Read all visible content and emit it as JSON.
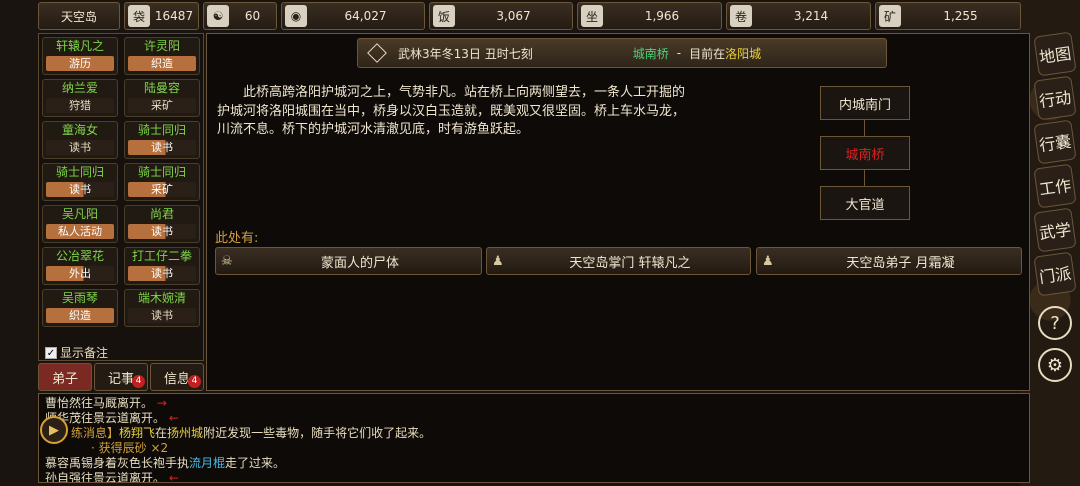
{
  "topbar": {
    "island": "天空岛",
    "resources": [
      {
        "icon": "coin-pouch-icon",
        "glyph": "袋",
        "value": "16487"
      },
      {
        "icon": "yin-yang-icon",
        "glyph": "☯",
        "value": "60"
      },
      {
        "icon": "copper-coin-icon",
        "glyph": "◉",
        "value": "64,027"
      },
      {
        "icon": "food-bowl-icon",
        "glyph": "饭",
        "value": "3,067"
      },
      {
        "icon": "meditation-icon",
        "glyph": "坐",
        "value": "1,966"
      },
      {
        "icon": "scroll-icon",
        "glyph": "卷",
        "value": "3,214"
      },
      {
        "icon": "ore-icon",
        "glyph": "矿",
        "value": "1,255"
      }
    ]
  },
  "disciples": [
    {
      "name": "轩辕凡之",
      "activity": "游历"
    },
    {
      "name": "许灵阳",
      "activity": "织造"
    },
    {
      "name": "纳兰爱",
      "activity": "狩猎"
    },
    {
      "name": "陆曼容",
      "activity": "采矿"
    },
    {
      "name": "童海女",
      "activity": "读书"
    },
    {
      "name": "骑士同归",
      "activity": "读书"
    },
    {
      "name": "骑士同归",
      "activity": "读书"
    },
    {
      "name": "骑士同归",
      "activity": "采矿"
    },
    {
      "name": "吴凡阳",
      "activity": "私人活动"
    },
    {
      "name": "尚君",
      "activity": "读书"
    },
    {
      "name": "公冶翠花",
      "activity": "外出"
    },
    {
      "name": "打工仔二拳",
      "activity": "读书"
    },
    {
      "name": "吴雨琴",
      "activity": "织造"
    },
    {
      "name": "端木婉清",
      "activity": "读书"
    }
  ],
  "show_remarks": "显示备注",
  "tabs": {
    "disciples": "弟子",
    "notes": "记事",
    "notes_badge": "4",
    "info": "信息",
    "info_badge": "4"
  },
  "header": {
    "date": "武林3年冬13日 丑时七刻",
    "location": "城南桥",
    "dash": "-",
    "current_prefix": "目前在",
    "current_city": "洛阳城"
  },
  "description": "此桥高跨洛阳护城河之上，气势非凡。站在桥上向两侧望去，一条人工开掘的护城河将洛阳城围在当中，桥身以汉白玉造就，既美观又很坚固。桥上车水马龙，川流不息。桥下的护城河水清澈见底，时有游鱼跃起。",
  "here_label": "此处有:",
  "npcs": [
    {
      "icon": "skull-icon",
      "glyph": "☠",
      "label": "蒙面人的尸体"
    },
    {
      "icon": "person-icon",
      "glyph": "♟",
      "label": "天空岛掌门 轩辕凡之"
    },
    {
      "icon": "person-icon",
      "glyph": "♟",
      "label": "天空岛弟子 月霜凝"
    }
  ],
  "map": {
    "north": "内城南门",
    "current": "城南桥",
    "south": "大官道"
  },
  "log": {
    "line1": "曹怡然往马厩离开。",
    "line1_arrow": "→",
    "line2": "师华茂往景云道离开。",
    "line2_arrow": "←",
    "line3_prefix": "练消息】",
    "line3_name": "杨翔飞",
    "line3_mid": "在",
    "line3_city": "扬州城",
    "line3_rest": "附近发现一些毒物，随手将它们收了起来。",
    "line4_prefix": "· 获得",
    "line4_item": "辰砂",
    "line4_count": "×2",
    "line5_a": "慕容禹锡身着灰色长袍手执",
    "line5_weapon": "流月棍",
    "line5_b": "走了过来。",
    "line6": "孙自强往景云道离开。",
    "line6_arrow": "←"
  },
  "right_menu": [
    "地图",
    "行动",
    "行囊",
    "工作",
    "武学",
    "门派"
  ],
  "colors": {
    "green": "#7fd54a",
    "orange": "#b5703d",
    "red": "#e02020",
    "gold": "#e8d040"
  }
}
